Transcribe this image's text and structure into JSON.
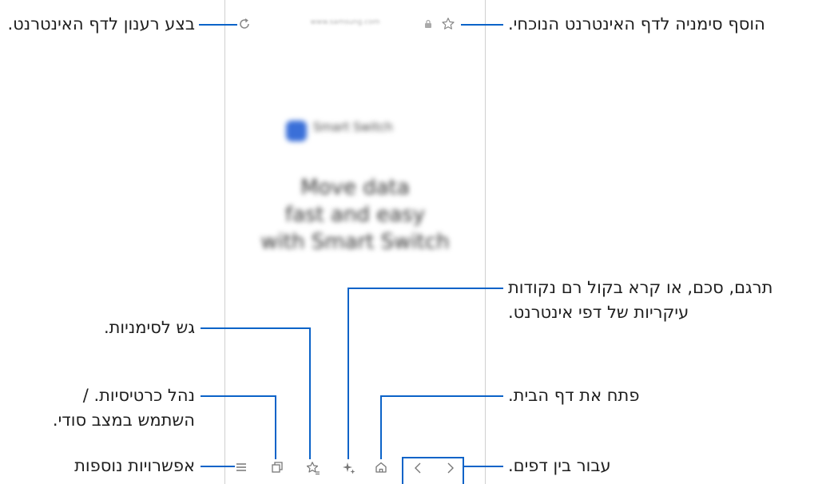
{
  "callouts": {
    "refresh": "בצע רענון לדף האינטרנט.",
    "bookmark_add": "הוסף סימניה לדף האינטרנט הנוכחי.",
    "ai_tools_line1": "תרגם, סכם, או קרא בקול רם נקודות",
    "ai_tools_line2": "עיקריות של דפי אינטרנט.",
    "bookmarks": "גש לסימניות.",
    "tabs_line1": "נהל כרטיסיות. /",
    "tabs_line2": "השתמש במצב סודי.",
    "home": "פתח את דף הבית.",
    "more": "אפשרויות נוספות",
    "navigate": "עבור בין דפים."
  },
  "browser": {
    "url": "www.samsung.com",
    "brand_name": "Smart Switch",
    "headline": "Move data\nfast and easy\nwith Smart Switch"
  },
  "icons": {
    "refresh": "refresh-icon",
    "lock": "lock-icon",
    "star": "star-icon",
    "menu": "menu-icon",
    "tabs": "tabs-icon",
    "bookmarks": "bookmarks-icon",
    "ai": "sparkle-icon",
    "home": "home-icon",
    "back": "chevron-left-icon",
    "forward": "chevron-right-icon"
  },
  "colors": {
    "accent": "#0b63c8",
    "brand": "#3a6fd8"
  }
}
